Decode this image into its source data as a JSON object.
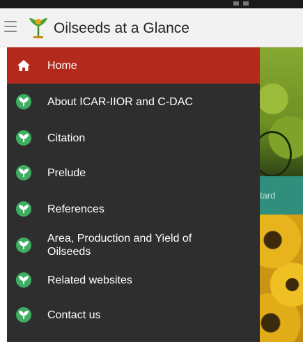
{
  "app": {
    "title": "Oilseeds at a Glance",
    "background_caption": "tard"
  },
  "icons": {
    "menu": "hamburger-icon",
    "logo": "oilseeds-logo-icon",
    "home": "home-icon",
    "item": "leaf-badge-icon"
  },
  "colors": {
    "app_bar": "#f2f2f2",
    "drawer": "#2e2e2e",
    "active_item": "#b32a1c",
    "icon_green": "#3fae63",
    "text": "#ffffff"
  },
  "drawer": {
    "items": [
      {
        "label": "Home",
        "active": true
      },
      {
        "label": "About ICAR-IIOR and C-DAC",
        "active": false
      },
      {
        "label": "Citation",
        "active": false
      },
      {
        "label": "Prelude",
        "active": false
      },
      {
        "label": "References",
        "active": false
      },
      {
        "label": "Area, Production and Yield of Oilseeds",
        "active": false
      },
      {
        "label": "Related websites",
        "active": false
      },
      {
        "label": "Contact us",
        "active": false
      }
    ]
  }
}
